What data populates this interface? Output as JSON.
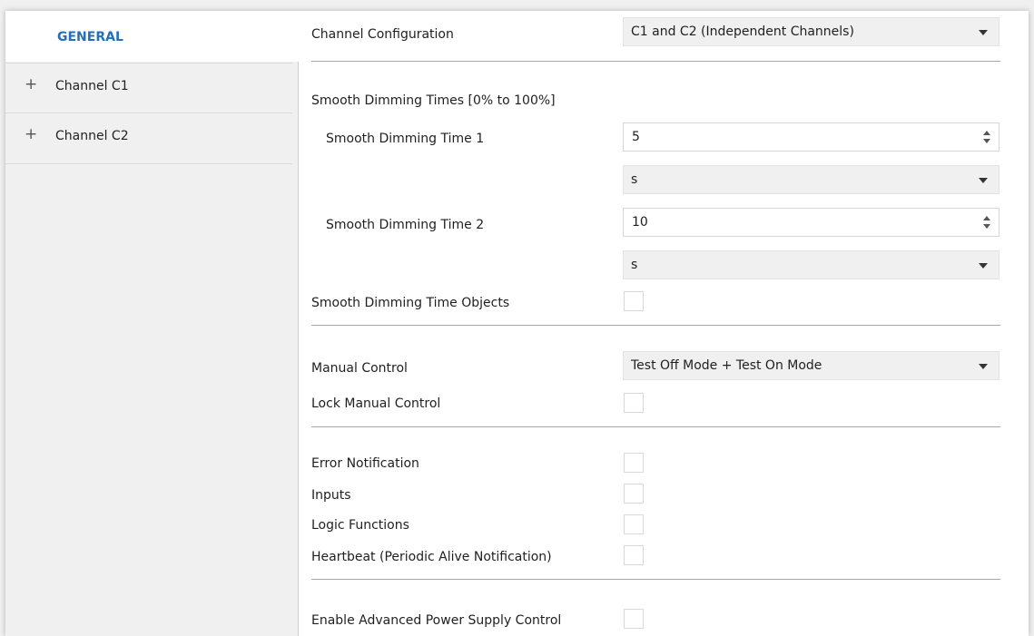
{
  "sidebar": {
    "general_label": "GENERAL",
    "items": [
      {
        "label": "Channel C1",
        "expand_icon": "+"
      },
      {
        "label": "Channel C2",
        "expand_icon": "+"
      }
    ]
  },
  "general": {
    "channel_configuration": {
      "label": "Channel Configuration",
      "value": "C1 and C2 (Independent Channels)"
    },
    "smooth_dimming": {
      "section_label": "Smooth Dimming Times [0% to 100%]",
      "time1": {
        "label": "Smooth Dimming Time 1",
        "value": "5",
        "unit": "s"
      },
      "time2": {
        "label": "Smooth Dimming Time 2",
        "value": "10",
        "unit": "s"
      },
      "objects_label": "Smooth Dimming Time Objects"
    },
    "manual_control": {
      "label": "Manual Control",
      "value": "Test Off Mode + Test On Mode",
      "lock_label": "Lock Manual Control"
    },
    "options": {
      "error_notification": "Error Notification",
      "inputs": "Inputs",
      "logic_functions": "Logic Functions",
      "heartbeat": "Heartbeat (Periodic Alive Notification)"
    },
    "advanced_power_label": "Enable Advanced Power Supply Control"
  },
  "colors": {
    "accent": "#2470b8",
    "sidebar_bg": "#f0f0f0",
    "panel_bg": "#ffffff",
    "separator": "#a8a8a8"
  }
}
